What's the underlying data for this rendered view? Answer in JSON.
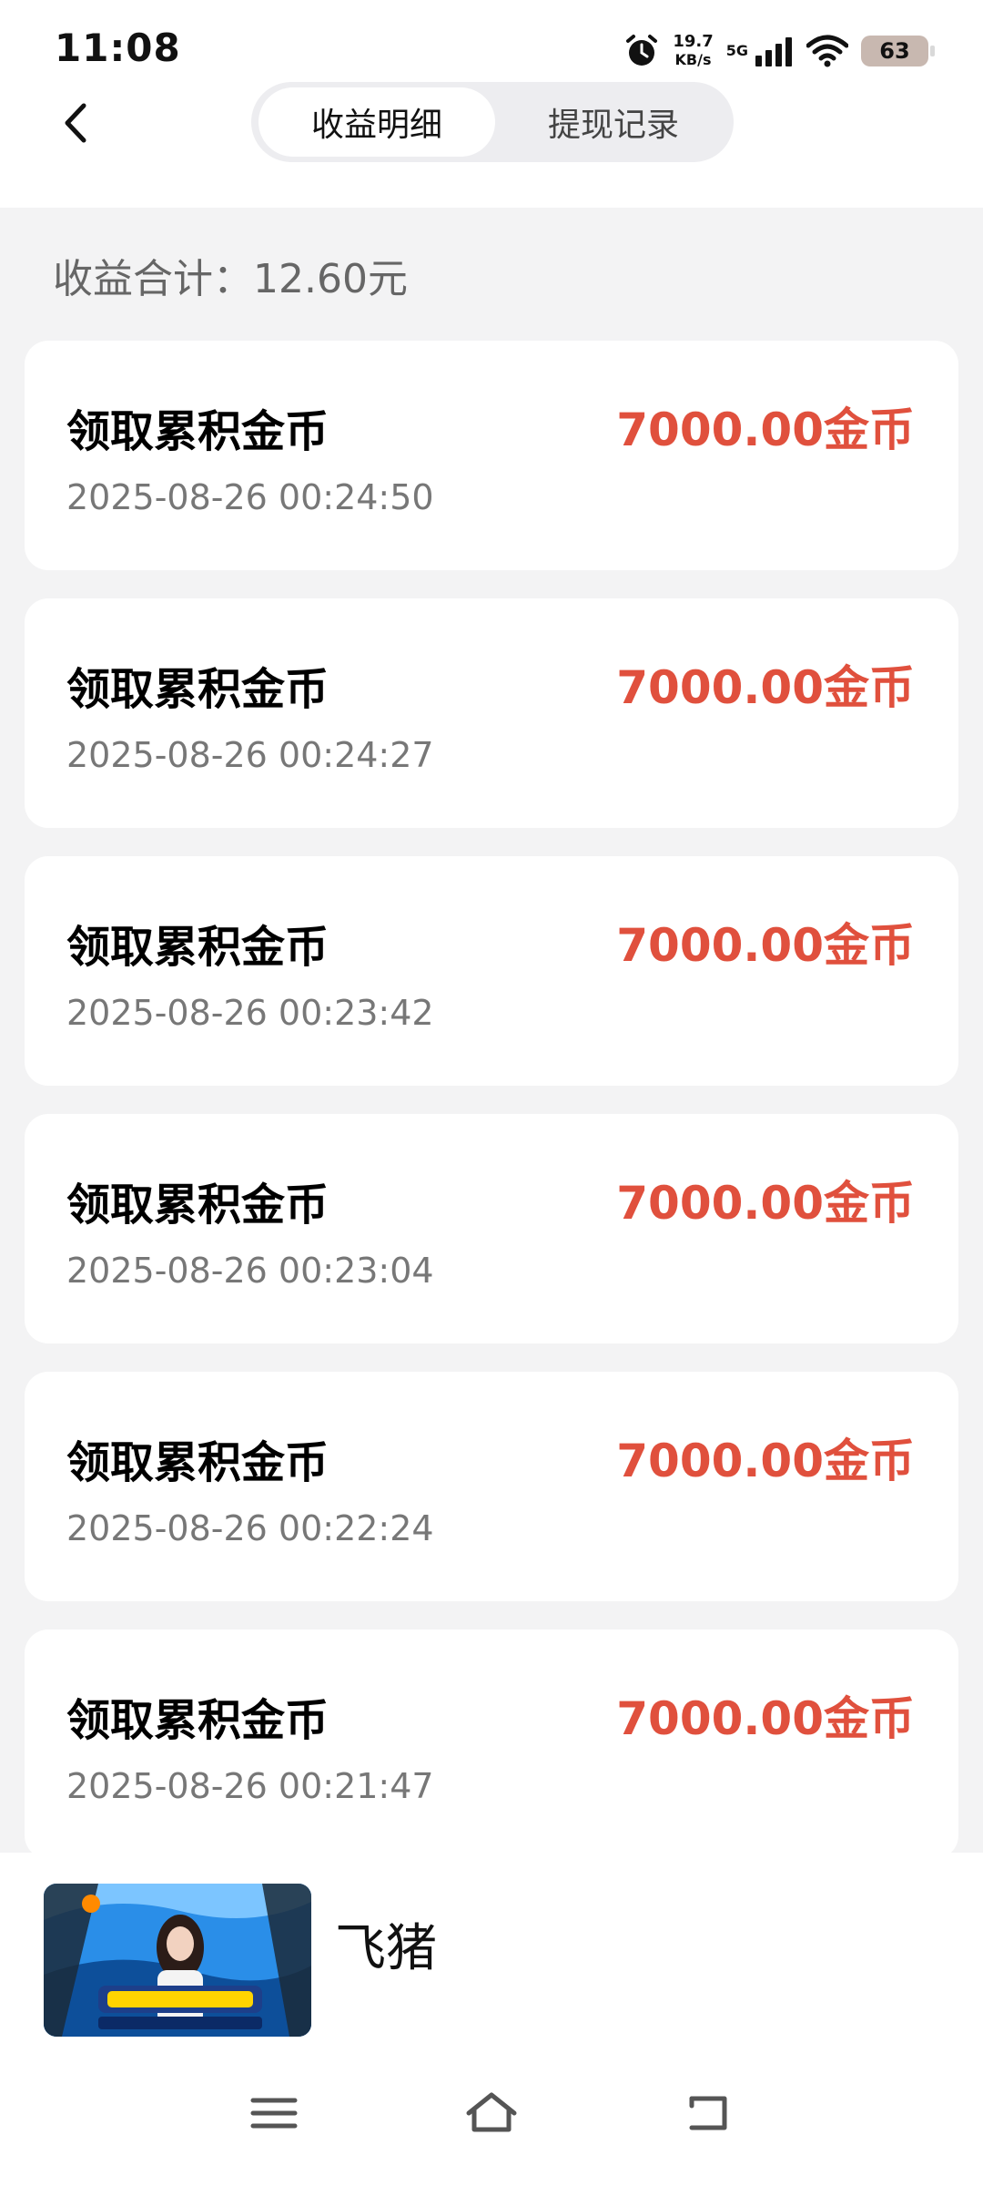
{
  "status_bar": {
    "time": "11:08",
    "net_speed": "19.7",
    "net_unit": "KB/s",
    "network": "5G",
    "battery": "63"
  },
  "header": {
    "tabs": [
      {
        "label": "收益明细",
        "active": true
      },
      {
        "label": "提现记录",
        "active": false
      }
    ]
  },
  "summary": {
    "text": "收益合计：12.60元"
  },
  "records": [
    {
      "title": "领取累积金币",
      "time": "2025-08-26 00:24:50",
      "amount": "7000.00金币"
    },
    {
      "title": "领取累积金币",
      "time": "2025-08-26 00:24:27",
      "amount": "7000.00金币"
    },
    {
      "title": "领取累积金币",
      "time": "2025-08-26 00:23:42",
      "amount": "7000.00金币"
    },
    {
      "title": "领取累积金币",
      "time": "2025-08-26 00:23:04",
      "amount": "7000.00金币"
    },
    {
      "title": "领取累积金币",
      "time": "2025-08-26 00:22:24",
      "amount": "7000.00金币"
    },
    {
      "title": "领取累积金币",
      "time": "2025-08-26 00:21:47",
      "amount": "7000.00金币"
    }
  ],
  "ad": {
    "title": "飞猪"
  },
  "colors": {
    "amount": "#e0503d",
    "background": "#f3f3f4"
  }
}
